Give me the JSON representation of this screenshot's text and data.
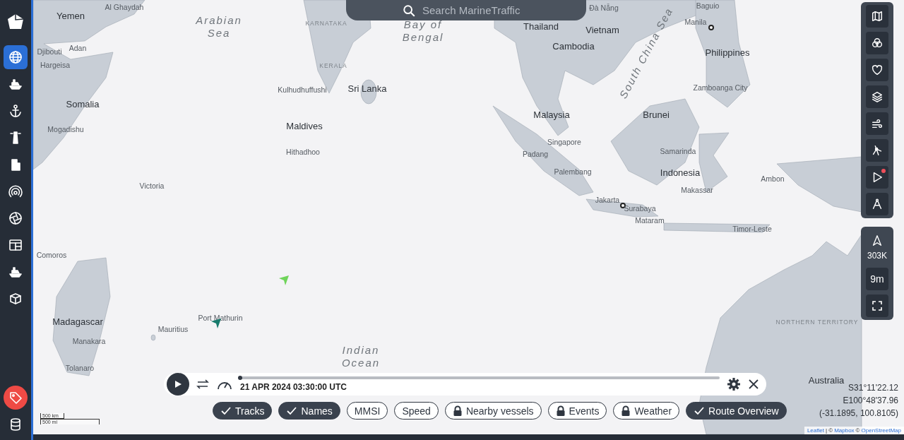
{
  "sidebar": {
    "items": [
      {
        "kind": "nav",
        "selected": true
      },
      {
        "kind": "nav",
        "selected": false
      },
      {
        "kind": "nav",
        "selected": false
      },
      {
        "kind": "nav",
        "selected": false
      },
      {
        "kind": "nav",
        "selected": false
      },
      {
        "kind": "nav",
        "selected": false
      },
      {
        "kind": "nav",
        "selected": false
      },
      {
        "kind": "nav",
        "selected": false
      },
      {
        "kind": "nav",
        "selected": false
      },
      {
        "kind": "nav",
        "selected": false
      },
      {
        "kind": "offer",
        "selected": false
      },
      {
        "kind": "nav",
        "selected": false
      }
    ]
  },
  "search": {
    "placeholder": "Search MarineTraffic"
  },
  "map": {
    "labels": [
      {
        "text": "Al Ghaydah",
        "kind": "place"
      },
      {
        "text": "Đà Nẵng",
        "kind": "place"
      },
      {
        "text": "Baguio",
        "kind": "place"
      },
      {
        "text": "Yemen",
        "kind": "country"
      },
      {
        "text": "Arabian Sea",
        "kind": "sea"
      },
      {
        "text": "KARNATAKA",
        "kind": "region"
      },
      {
        "text": "Bay of Bengal",
        "kind": "sea"
      },
      {
        "text": "Thailand",
        "kind": "country"
      },
      {
        "text": "Vietnam",
        "kind": "country"
      },
      {
        "text": "Manila",
        "kind": "capital"
      },
      {
        "text": "Djibouti",
        "kind": "place"
      },
      {
        "text": "Adan",
        "kind": "place"
      },
      {
        "text": "Cambodia",
        "kind": "country"
      },
      {
        "text": "South China Sea",
        "kind": "sea"
      },
      {
        "text": "Philippines",
        "kind": "country"
      },
      {
        "text": "Hargeisa",
        "kind": "place"
      },
      {
        "text": "KERALA",
        "kind": "region"
      },
      {
        "text": "Kulhudhuffushi",
        "kind": "place"
      },
      {
        "text": "Sri Lanka",
        "kind": "country"
      },
      {
        "text": "Zamboanga City",
        "kind": "place"
      },
      {
        "text": "Somalia",
        "kind": "country"
      },
      {
        "text": "Malaysia",
        "kind": "country"
      },
      {
        "text": "Brunei",
        "kind": "country"
      },
      {
        "text": "Mogadishu",
        "kind": "place"
      },
      {
        "text": "Maldives",
        "kind": "country"
      },
      {
        "text": "Singapore",
        "kind": "place"
      },
      {
        "text": "Hithadhoo",
        "kind": "place"
      },
      {
        "text": "Padang",
        "kind": "place"
      },
      {
        "text": "Samarinda",
        "kind": "place"
      },
      {
        "text": "Palembang",
        "kind": "place"
      },
      {
        "text": "Indonesia",
        "kind": "country"
      },
      {
        "text": "Ambon",
        "kind": "place"
      },
      {
        "text": "Victoria",
        "kind": "place"
      },
      {
        "text": "Makassar",
        "kind": "place"
      },
      {
        "text": "Jakarta",
        "kind": "capital"
      },
      {
        "text": "Surabaya",
        "kind": "place"
      },
      {
        "text": "Mataram",
        "kind": "place"
      },
      {
        "text": "Timor-Leste",
        "kind": "place"
      },
      {
        "text": "Comoros",
        "kind": "place"
      },
      {
        "text": "Madagascar",
        "kind": "country"
      },
      {
        "text": "Port Mathurin",
        "kind": "place"
      },
      {
        "text": "Mauritius",
        "kind": "place"
      },
      {
        "text": "NORTHERN TERRITORY",
        "kind": "region"
      },
      {
        "text": "Manakara",
        "kind": "place"
      },
      {
        "text": "Tolanaro",
        "kind": "place"
      },
      {
        "text": "Indian Ocean",
        "kind": "sea"
      },
      {
        "text": "Australia",
        "kind": "country"
      }
    ],
    "vessels": [
      {
        "color": "#6fd45a"
      },
      {
        "color": "#177a6c"
      }
    ]
  },
  "right_tools": {
    "items": [
      {
        "notification": false
      },
      {
        "notification": false
      },
      {
        "notification": false
      },
      {
        "notification": false
      },
      {
        "notification": false
      },
      {
        "notification": false
      },
      {
        "notification": true
      },
      {
        "notification": false
      }
    ]
  },
  "vessel_count": "303K",
  "time_filter": "9m",
  "timeline": {
    "timestamp": "21 APR 2024 03:30:00 UTC",
    "level": 0
  },
  "filters": [
    {
      "label": "Tracks",
      "checked": true,
      "locked": false
    },
    {
      "label": "Names",
      "checked": true,
      "locked": false
    },
    {
      "label": "MMSI",
      "checked": false,
      "locked": false
    },
    {
      "label": "Speed",
      "checked": false,
      "locked": false
    },
    {
      "label": "Nearby vessels",
      "checked": false,
      "locked": true
    },
    {
      "label": "Events",
      "checked": false,
      "locked": true
    },
    {
      "label": "Weather",
      "checked": false,
      "locked": true
    },
    {
      "label": "Route Overview",
      "checked": true,
      "locked": false
    }
  ],
  "coordinates": {
    "latitude": "S31°11'22.12",
    "longitude": "E100°48'37.96",
    "decimal": "(-31.1895, 100.8105)"
  },
  "scale": {
    "metric": "500 km",
    "imperial": "500 mi"
  },
  "attribution": {
    "links": [
      {
        "text": "Leaflet"
      },
      {
        "prefix": "| ©",
        "text": "Mapbox"
      },
      {
        "prefix": "©",
        "text": "OpenStreetMap"
      }
    ]
  }
}
